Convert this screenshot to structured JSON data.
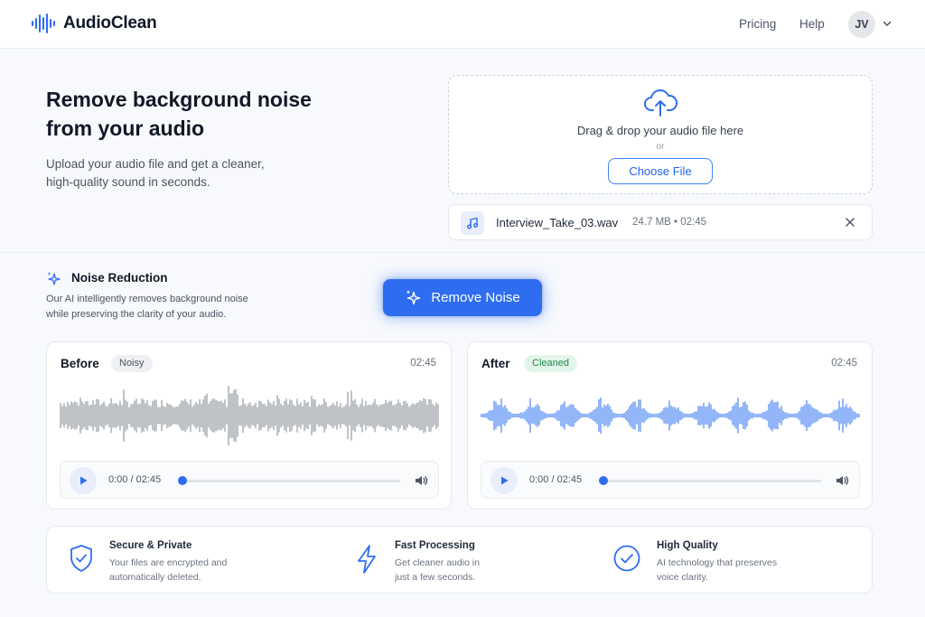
{
  "app": {
    "name": "AudioClean"
  },
  "nav": {
    "pricing": "Pricing",
    "help": "Help",
    "avatar_initials": "JV"
  },
  "hero": {
    "title_line1": "Remove background noise",
    "title_line2": "from your audio",
    "subtitle_line1": "Upload your audio file and get a cleaner,",
    "subtitle_line2": "high-quality sound in seconds."
  },
  "upload": {
    "drop_text": "Drag & drop your audio file here",
    "or_text": "or",
    "choose_label": "Choose File"
  },
  "file": {
    "name": "Interview_Take_03.wav",
    "meta": "24.7 MB  •  02:45"
  },
  "noise_reduction": {
    "title": "Noise Reduction",
    "desc_line1": "Our AI intelligently removes background noise",
    "desc_line2": "while preserving the clarity of your audio."
  },
  "action": {
    "remove_label": "Remove Noise"
  },
  "before": {
    "title": "Before",
    "badge": "Noisy",
    "duration": "02:45",
    "player_time": "0:00 / 02:45",
    "progress": 0
  },
  "after": {
    "title": "After",
    "badge": "Cleaned",
    "duration": "02:45",
    "player_time": "0:00 / 02:45",
    "progress": 0
  },
  "features": [
    {
      "title": "Secure & Private",
      "desc_line1": "Your files are encrypted and",
      "desc_line2": "automatically deleted.",
      "icon": "shield-check-icon"
    },
    {
      "title": "Fast Processing",
      "desc_line1": "Get cleaner audio in",
      "desc_line2": "just a few seconds.",
      "icon": "lightning-icon"
    },
    {
      "title": "High Quality",
      "desc_line1": "AI technology that preserves",
      "desc_line2": "voice clarity.",
      "icon": "check-circle-icon"
    }
  ],
  "colors": {
    "accent": "#2f6df0",
    "noisy_wave": "#8a9099",
    "clean_wave": "#3b7bf2",
    "clean_badge": "#1f8a4c"
  }
}
